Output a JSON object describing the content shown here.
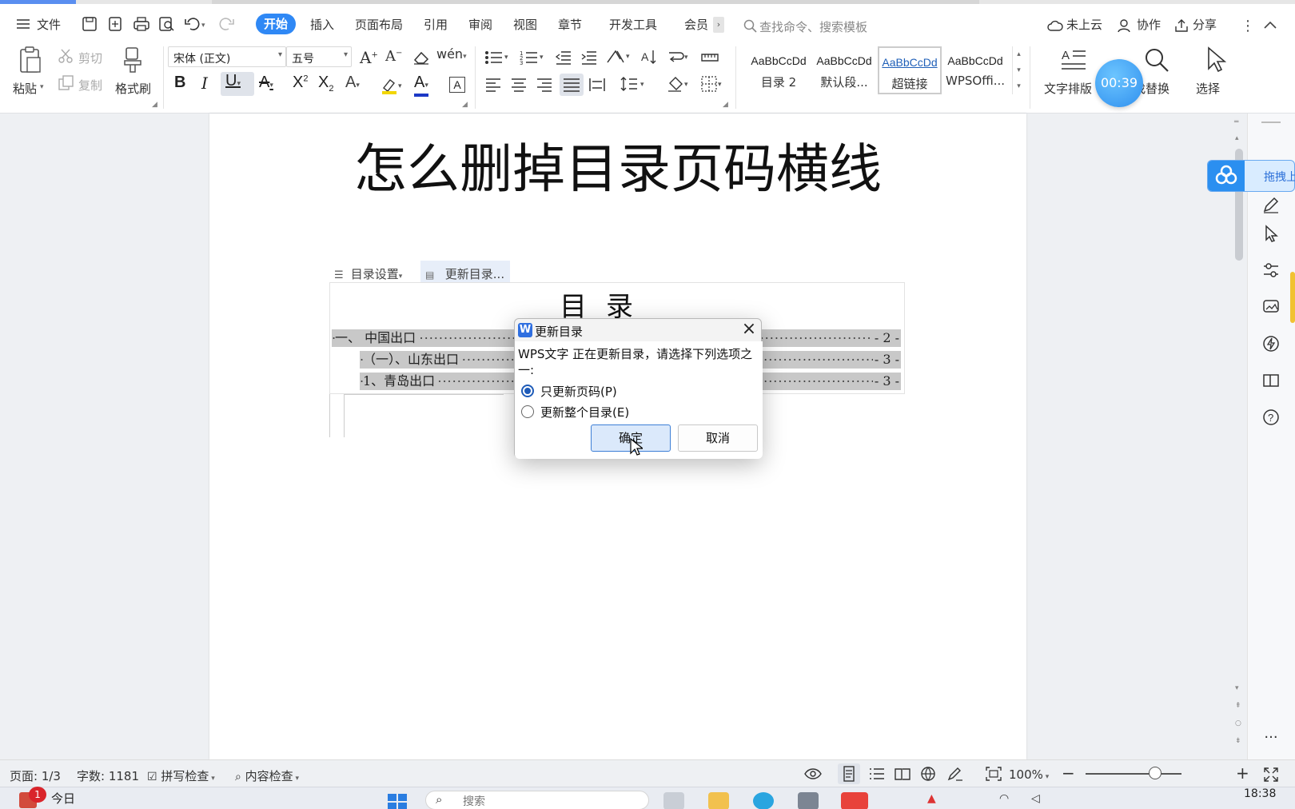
{
  "menubar": {
    "file_label": "文件",
    "tabs": [
      "开始",
      "插入",
      "页面布局",
      "引用",
      "审阅",
      "视图",
      "章节",
      "开发工具",
      "会员"
    ],
    "search_placeholder": "查找命令、搜索模板",
    "cloud_status": "未上云",
    "collaborate_label": "协作",
    "share_label": "分享"
  },
  "ribbon": {
    "paste_label": "粘贴",
    "cut_label": "剪切",
    "copy_label": "复制",
    "format_painter_label": "格式刷",
    "font_name": "宋体 (正文)",
    "font_size": "五号",
    "styles": [
      {
        "sample": "AaBbCcDd",
        "name": "目录 2"
      },
      {
        "sample": "AaBbCcDd",
        "name": "默认段..."
      },
      {
        "sample": "AaBbCcDd",
        "name": "超链接"
      },
      {
        "sample": "AaBbCcDd",
        "name": "WPSOffi..."
      }
    ],
    "text_layout_label": "文字排版",
    "find_replace_label": "找替换",
    "select_label": "选择",
    "timer": "00:39"
  },
  "document": {
    "title": "怎么删掉目录页码横线",
    "toc_settings_label": "目录设置",
    "update_toc_label": "更新目录...",
    "toc_heading": "目录",
    "toc_entries": [
      {
        "text": "一、 中国出口",
        "page": "- 2 -"
      },
      {
        "text": "（一）、山东出口",
        "page": "- 3 -"
      },
      {
        "text": "1、青岛出口",
        "page": "- 3 -"
      }
    ]
  },
  "dialog": {
    "title": "更新目录",
    "message": "WPS文字 正在更新目录，请选择下列选项之一:",
    "option_page_only": "只更新页码(P)",
    "option_whole": "更新整个目录(E)",
    "selected_option": "只更新页码(P)",
    "ok_label": "确定",
    "cancel_label": "取消"
  },
  "side_widget_label": "拖拽上",
  "statusbar": {
    "page": "页面: 1/3",
    "word_count": "字数: 1181",
    "spell_check": "拼写检查",
    "content_check": "内容检查",
    "zoom": "100%"
  },
  "taskbar": {
    "notification_count": "1",
    "today_label": "今日",
    "search_label": "搜索",
    "clock": "18:38"
  },
  "colors": {
    "accent": "#2f88f5",
    "toc_highlight": "#c8c8c8",
    "dialog_primary": "#dbe9fb"
  }
}
